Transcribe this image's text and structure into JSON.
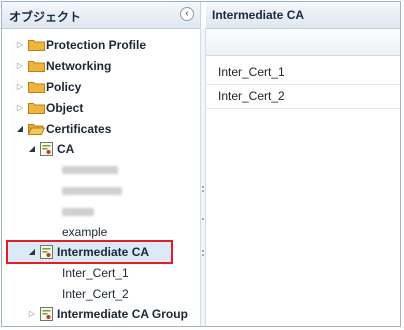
{
  "left_panel": {
    "title": "オブジェクト",
    "collapse_icon": "‹",
    "tree": [
      {
        "label": "Protection Profile",
        "toggle": "▷",
        "icon": "folder-icon"
      },
      {
        "label": "Networking",
        "toggle": "▷",
        "icon": "folder-icon"
      },
      {
        "label": "Policy",
        "toggle": "▷",
        "icon": "folder-icon"
      },
      {
        "label": "Object",
        "toggle": "▷",
        "icon": "folder-icon"
      },
      {
        "label": "Certificates",
        "toggle": "◢",
        "icon": "folder-open-icon"
      },
      {
        "label": "CA",
        "toggle": "◢",
        "icon": "certificate-icon"
      },
      {
        "label": "example"
      },
      {
        "label": "Intermediate CA",
        "toggle": "◢",
        "icon": "certificate-icon",
        "selected": true
      },
      {
        "label": "Inter_Cert_1"
      },
      {
        "label": "Inter_Cert_2"
      },
      {
        "label": "Intermediate CA Group",
        "toggle": "▷",
        "icon": "certificate-icon"
      }
    ]
  },
  "right_panel": {
    "title": "Intermediate CA",
    "rows": [
      "Inter_Cert_1",
      "Inter_Cert_2"
    ]
  },
  "colors": {
    "highlight_border": "#e02020",
    "selection_bg": "#dbe9f8",
    "folder": "#f0b43c"
  }
}
